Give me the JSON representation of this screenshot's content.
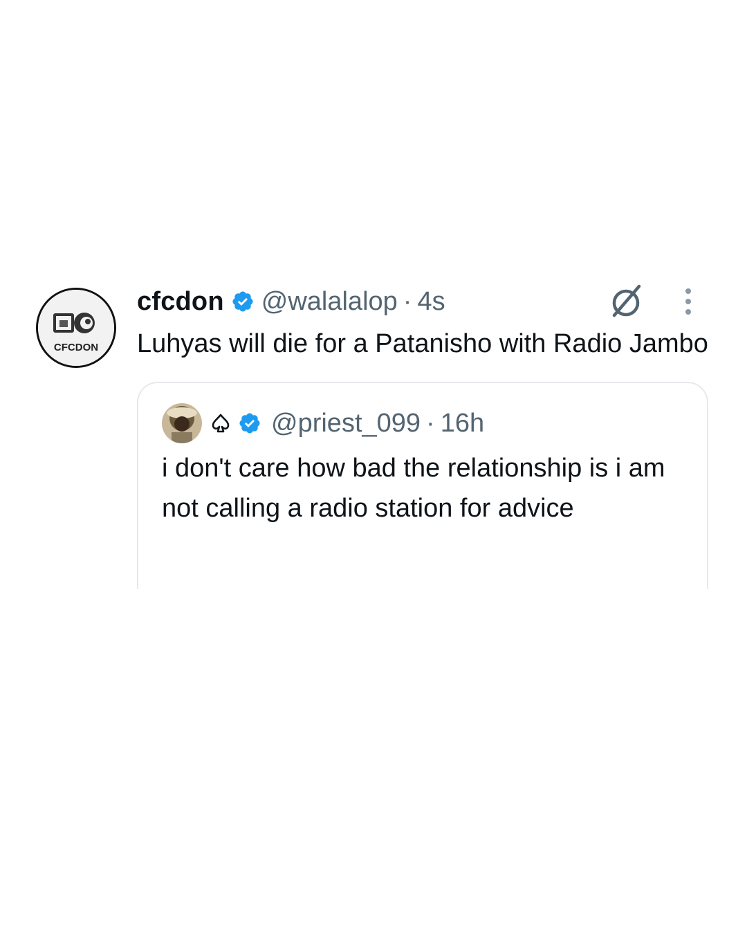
{
  "tweet": {
    "display_name": "cfcdon",
    "handle": "@walalalop",
    "separator": "·",
    "time": "4s",
    "text": "Luhyas will die for a Patanisho with Radio Jambo",
    "avatar_text": "CFCDON",
    "verified_color": "#1d9bf0"
  },
  "quote": {
    "handle": "@priest_099",
    "separator": "·",
    "time": "16h",
    "text": "i don't care how bad the relationship is i am not calling a radio station for advice"
  },
  "icons": {
    "verified": "verified-badge-icon",
    "grok": "grok-icon",
    "more": "more-options-icon",
    "spade": "spade-icon"
  },
  "colors": {
    "text": "#0f1419",
    "secondary": "#536471",
    "border": "#e6e9ec",
    "verified": "#1d9bf0"
  }
}
